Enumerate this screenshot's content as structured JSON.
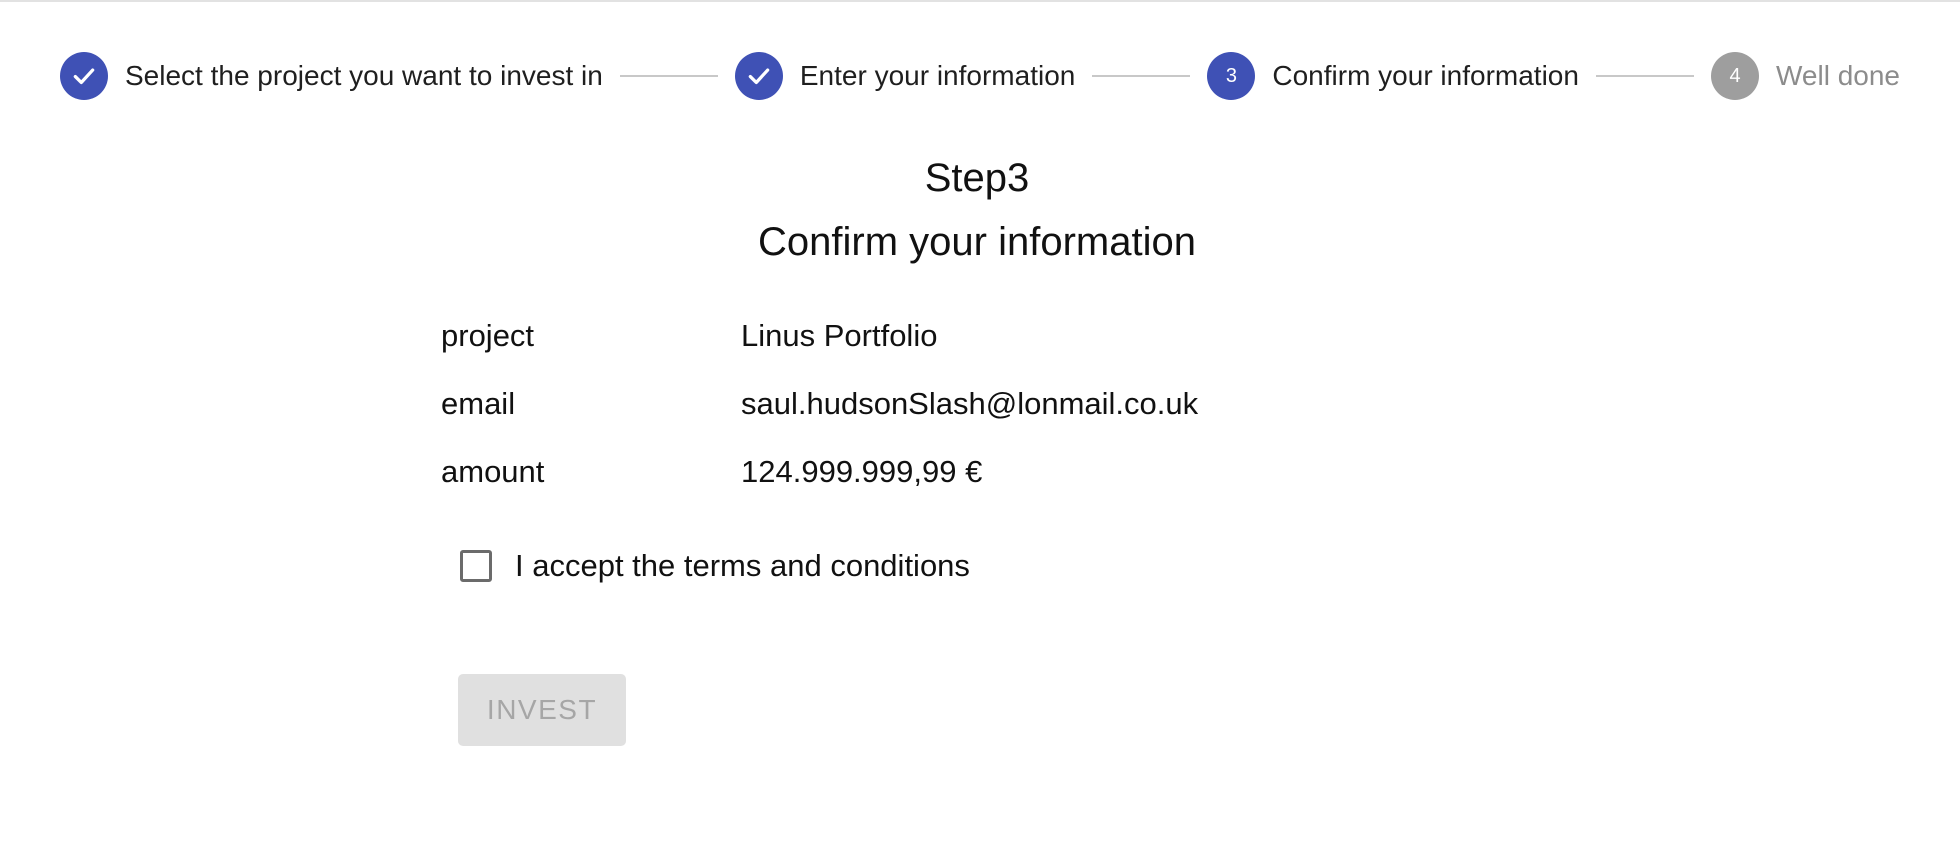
{
  "stepper": {
    "steps": [
      {
        "number": "1",
        "label": "Select the project you want to invest in",
        "state": "completed",
        "icon": "check-icon"
      },
      {
        "number": "2",
        "label": "Enter your information",
        "state": "completed",
        "icon": "check-icon"
      },
      {
        "number": "3",
        "label": "Confirm your information",
        "state": "active"
      },
      {
        "number": "4",
        "label": "Well done",
        "state": "pending"
      }
    ]
  },
  "main": {
    "step_title": "Step3",
    "subtitle": "Confirm your information",
    "summary": [
      {
        "label": "project",
        "value": "Linus Portfolio"
      },
      {
        "label": "email",
        "value": "saul.hudsonSlash@lonmail.co.uk"
      },
      {
        "label": "amount",
        "value": "124.999.999,99 €"
      }
    ],
    "terms": {
      "label": "I accept the terms and conditions",
      "checked": false
    },
    "invest_button": {
      "label": "INVEST",
      "disabled": true
    }
  },
  "colors": {
    "accent": "#3f51b5",
    "inactive_step": "#9e9e9e",
    "connector": "#c8c8c8",
    "disabled_button_bg": "#e0e0e0",
    "disabled_button_text": "#a6a6a6"
  }
}
